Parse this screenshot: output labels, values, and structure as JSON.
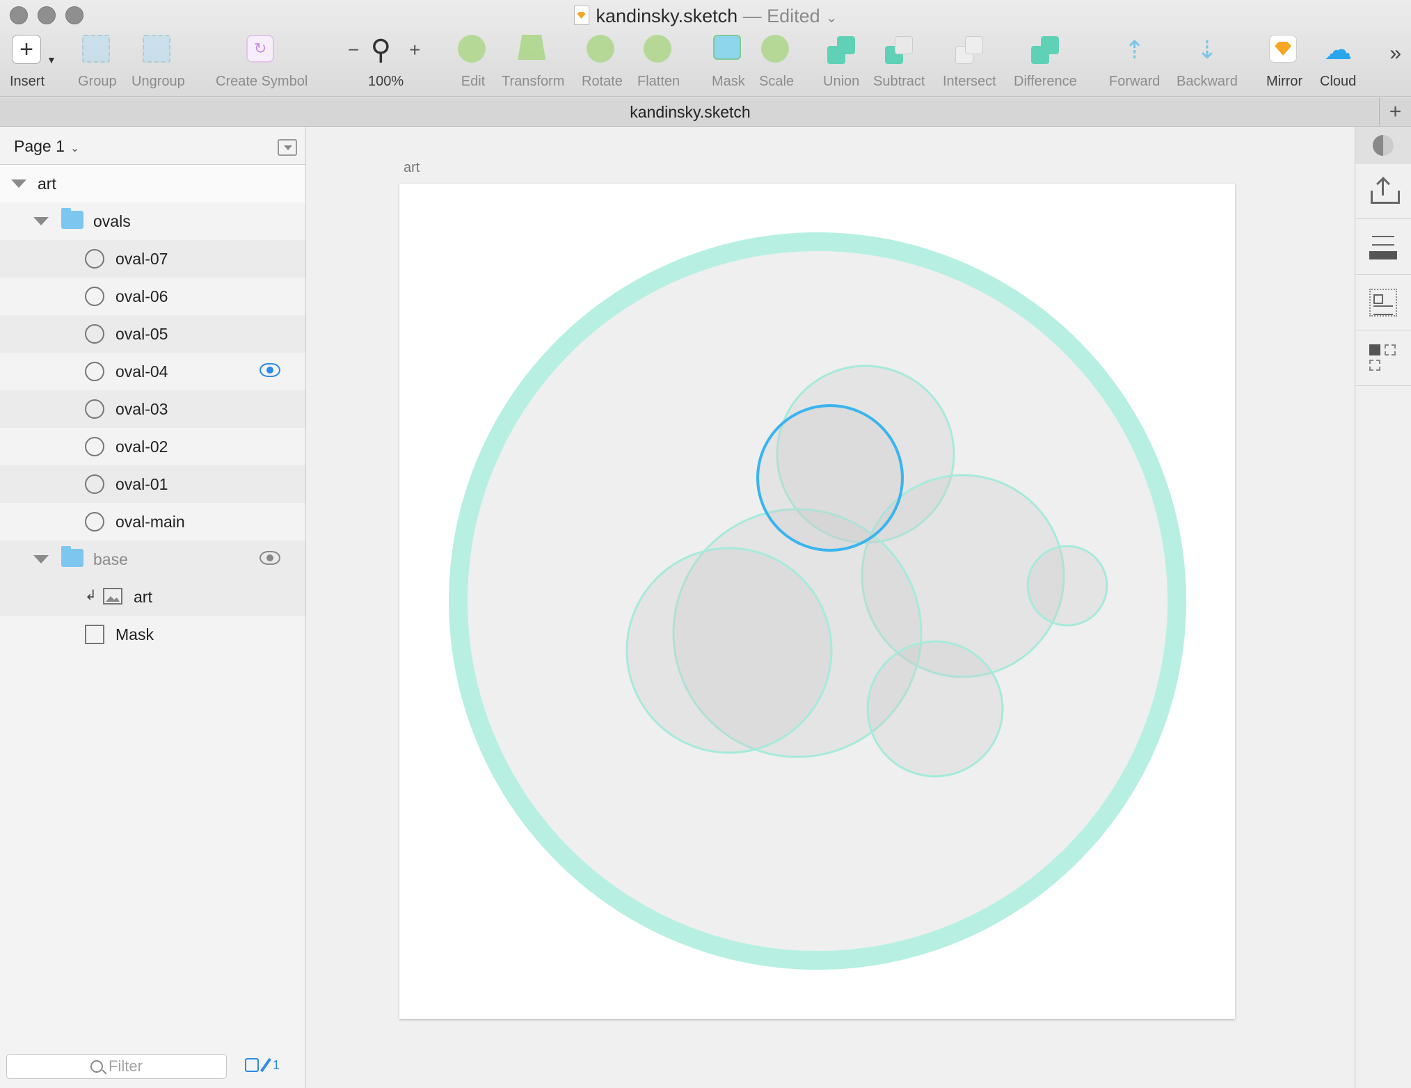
{
  "window": {
    "filename": "kandinsky.sketch",
    "status": "— Edited"
  },
  "toolbar": {
    "insert": "Insert",
    "group": "Group",
    "ungroup": "Ungroup",
    "create_symbol": "Create Symbol",
    "zoom": "100%",
    "edit": "Edit",
    "transform": "Transform",
    "rotate": "Rotate",
    "flatten": "Flatten",
    "mask": "Mask",
    "scale": "Scale",
    "union": "Union",
    "subtract": "Subtract",
    "intersect": "Intersect",
    "difference": "Difference",
    "forward": "Forward",
    "backward": "Backward",
    "mirror": "Mirror",
    "cloud": "Cloud"
  },
  "tab": {
    "title": "kandinsky.sketch"
  },
  "sidebar": {
    "page": "Page 1",
    "layers": [
      {
        "name": "art",
        "kind": "artboard"
      },
      {
        "name": "ovals",
        "kind": "folder"
      },
      {
        "name": "oval-07",
        "kind": "oval"
      },
      {
        "name": "oval-06",
        "kind": "oval"
      },
      {
        "name": "oval-05",
        "kind": "oval"
      },
      {
        "name": "oval-04",
        "kind": "oval",
        "visibility": "shown-active"
      },
      {
        "name": "oval-03",
        "kind": "oval"
      },
      {
        "name": "oval-02",
        "kind": "oval"
      },
      {
        "name": "oval-01",
        "kind": "oval"
      },
      {
        "name": "oval-main",
        "kind": "oval"
      },
      {
        "name": "base",
        "kind": "folder",
        "visibility": "shown"
      },
      {
        "name": "art",
        "kind": "image-masked"
      },
      {
        "name": "Mask",
        "kind": "rectangle"
      }
    ],
    "filter_placeholder": "Filter",
    "slice_count": "1"
  },
  "canvas": {
    "artboard_label": "art",
    "colors": {
      "ring": "#b7f0e2",
      "inner_fill": "#efefef",
      "oval_stroke": "#a6eadb",
      "selected_stroke": "#3ab4ef"
    }
  }
}
